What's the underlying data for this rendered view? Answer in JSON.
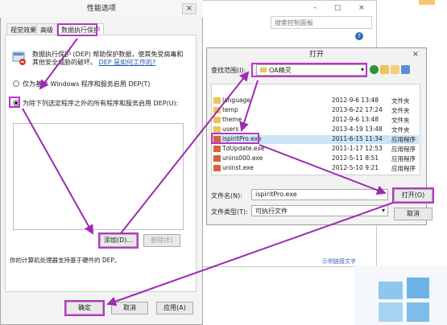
{
  "background_window": {
    "search_placeholder": "搜索控制面板",
    "minimize": "–",
    "maximize": "□",
    "close": "×",
    "help": "?",
    "footer_text": "示例链接文字"
  },
  "perf_dialog": {
    "title": "性能选项",
    "close": "×",
    "tabs": [
      "视觉效果",
      "高级",
      "数据执行保护"
    ],
    "active_tab": 2,
    "description": "数据执行保护 (DEP) 帮助保护数据，使其免受病毒和其他安全威胁的破坏。",
    "link": "DEP 是如何工作的?",
    "option1": "仅为基本 Windows 程序和服务启用 DEP(T)",
    "option2": "为除下列选定程序之外的所有程序和服务启用 DEP(U):",
    "selected_option": 2,
    "add_button": "添加(D)...",
    "delete_button": "删除(E)",
    "note": "你的计算机处理器支持基于硬件的 DEP。",
    "ok_button": "确定",
    "cancel_button": "取消",
    "apply_button": "应用(A)"
  },
  "open_dialog": {
    "title": "打开",
    "close": "×",
    "lookin_label": "查找范围(I):",
    "lookin_value": "OA精灵",
    "files": [
      {
        "name": "language",
        "date": "2012-9-6 13:48",
        "type": "文件夹",
        "kind": "folder"
      },
      {
        "name": "temp",
        "date": "2013-6-22 17:24",
        "type": "文件夹",
        "kind": "folder"
      },
      {
        "name": "theme",
        "date": "2012-9-6 13:48",
        "type": "文件夹",
        "kind": "folder"
      },
      {
        "name": "users",
        "date": "2013-4-19 13:48",
        "type": "文件夹",
        "kind": "folder"
      },
      {
        "name": "ispiritPro.exe",
        "date": "2011-6-15 11:34",
        "type": "应用程序",
        "kind": "app"
      },
      {
        "name": "TdUpdate.exe",
        "date": "2011-1-17 12:53",
        "type": "应用程序",
        "kind": "app"
      },
      {
        "name": "unins000.exe",
        "date": "2012-5-11 8:51",
        "type": "应用程序",
        "kind": "app"
      },
      {
        "name": "uninst.exe",
        "date": "2012-5-10 9:21",
        "type": "应用程序",
        "kind": "app"
      }
    ],
    "selected_file": 4,
    "filename_label": "文件名(N):",
    "filename_value": "ispiritPro.exe",
    "filetype_label": "文件类型(T):",
    "filetype_value": "可执行文件",
    "open_button": "打开(O)",
    "cancel_button": "取消"
  },
  "colors": {
    "highlight": "#b935c8",
    "selected_row": "#cce4f7",
    "link": "#1a57b5"
  }
}
